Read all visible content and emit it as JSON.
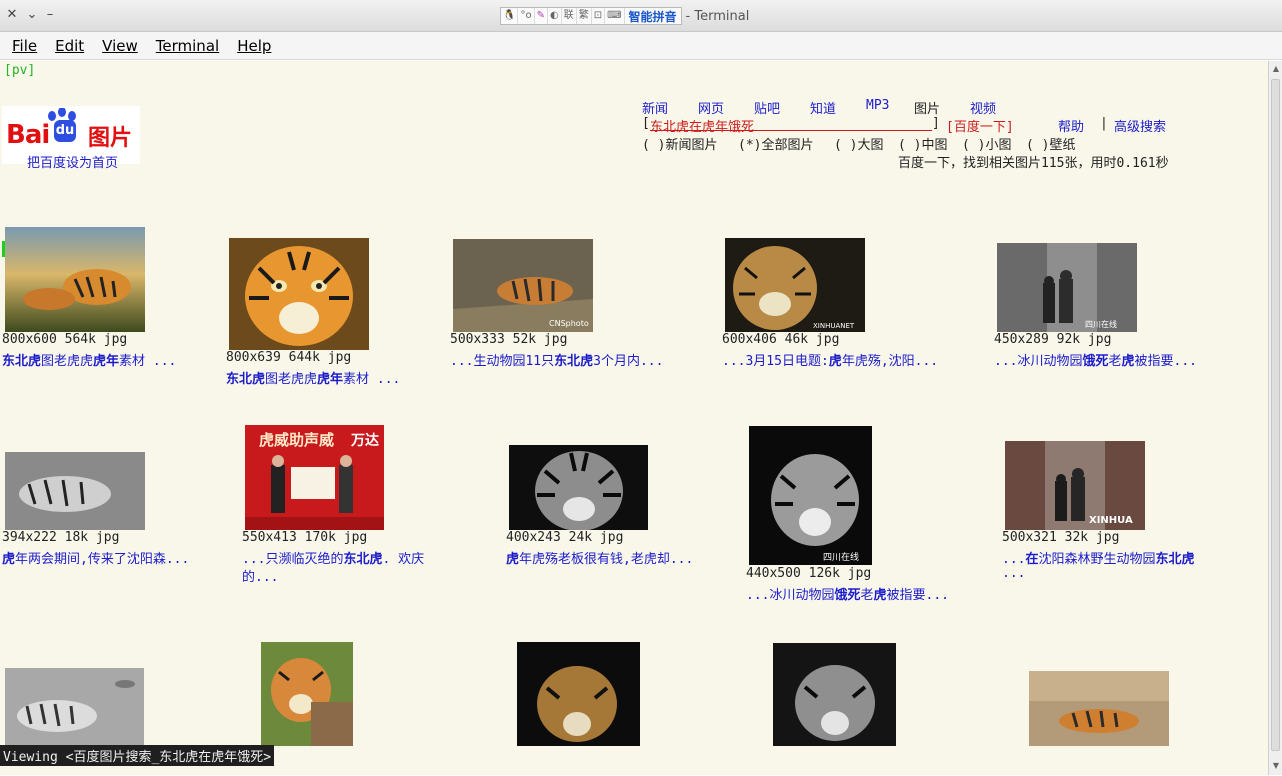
{
  "window": {
    "title": "Terminal",
    "ime": {
      "name": "智能拼音",
      "cells": [
        "联",
        "繁"
      ]
    }
  },
  "menu": [
    "File",
    "Edit",
    "View",
    "Terminal",
    "Help"
  ],
  "terminal": {
    "mode_tag": "[pv]",
    "logo": {
      "brand": "Bai",
      "du": "du",
      "cn": "图片",
      "home_link": "把百度设为首页"
    },
    "nav_links": [
      "新闻",
      "网页",
      "贴吧",
      "知道",
      "MP3",
      "图片",
      "视频"
    ],
    "search": {
      "open": "[",
      "query": "东北虎在虎年饿死",
      "close": "]",
      "button": "[百度一下]",
      "help": "帮助",
      "sep": "|",
      "advanced": "高级搜索"
    },
    "filters": [
      "( )新闻图片",
      "(*)全部图片",
      "( )大图",
      "( )中图",
      "( )小图",
      "( )壁纸"
    ],
    "result_summary": "百度一下，找到相关图片115张，用时0.161秒",
    "rows": [
      [
        {
          "meta": "800x600 564k jpg",
          "caption_parts": [
            [
              "东北虎",
              true
            ],
            [
              "图老虎虎",
              false
            ],
            [
              "虎年",
              true
            ],
            [
              "素材 ...",
              false
            ]
          ]
        },
        {
          "meta": "800x639 644k jpg",
          "caption_parts": [
            [
              "东北虎",
              true
            ],
            [
              "图老虎虎",
              false
            ],
            [
              "虎年",
              true
            ],
            [
              "素材 ...",
              false
            ]
          ]
        },
        {
          "meta": "500x333 52k jpg",
          "caption_parts": [
            [
              "...生动物园11只",
              false
            ],
            [
              "东北虎",
              true
            ],
            [
              "3个月内...",
              false
            ]
          ]
        },
        {
          "meta": "600x406 46k jpg",
          "caption_parts": [
            [
              "...3月15日电题:",
              false
            ],
            [
              "虎",
              true
            ],
            [
              "年虎殇,沈阳...",
              false
            ]
          ]
        },
        {
          "meta": "450x289 92k jpg",
          "caption_parts": [
            [
              "...冰川动物园",
              false
            ],
            [
              "饿死",
              true
            ],
            [
              "老",
              false
            ],
            [
              "虎",
              true
            ],
            [
              "被指要...",
              false
            ]
          ]
        }
      ],
      [
        {
          "meta": "394x222 18k jpg",
          "caption_parts": [
            [
              "虎",
              true
            ],
            [
              "年两会期间,传来了沈阳森...",
              false
            ]
          ]
        },
        {
          "meta": "550x413 170k jpg",
          "caption_parts": [
            [
              "...只濒临灭绝的",
              false
            ],
            [
              "东北虎",
              true
            ],
            [
              ". 欢庆",
              false
            ]
          ],
          "caption_line2": "的..."
        },
        {
          "meta": "400x243 24k jpg",
          "caption_parts": [
            [
              "虎",
              true
            ],
            [
              "年虎殇老板很有钱,老虎却...",
              false
            ]
          ]
        },
        {
          "meta": "440x500 126k jpg",
          "caption_parts": [
            [
              "...冰川动物园",
              false
            ],
            [
              "饿死",
              true
            ],
            [
              "老",
              false
            ],
            [
              "虎",
              true
            ],
            [
              "被指要...",
              false
            ]
          ]
        },
        {
          "meta": "500x321 32k jpg",
          "caption_parts": [
            [
              "...",
              false
            ],
            [
              "在",
              true
            ],
            [
              "沈阳森林野生动物园",
              false
            ],
            [
              "东北虎",
              true
            ]
          ],
          "caption_line2": "..."
        }
      ]
    ],
    "image_labels": [
      "CNSphoto",
      "XINHUANET",
      "四川在线",
      "虎威助声威",
      "万达",
      "四川在线",
      "XINHUA"
    ],
    "status_line": "Viewing <百度图片搜索_东北虎在虎年饿死>"
  }
}
